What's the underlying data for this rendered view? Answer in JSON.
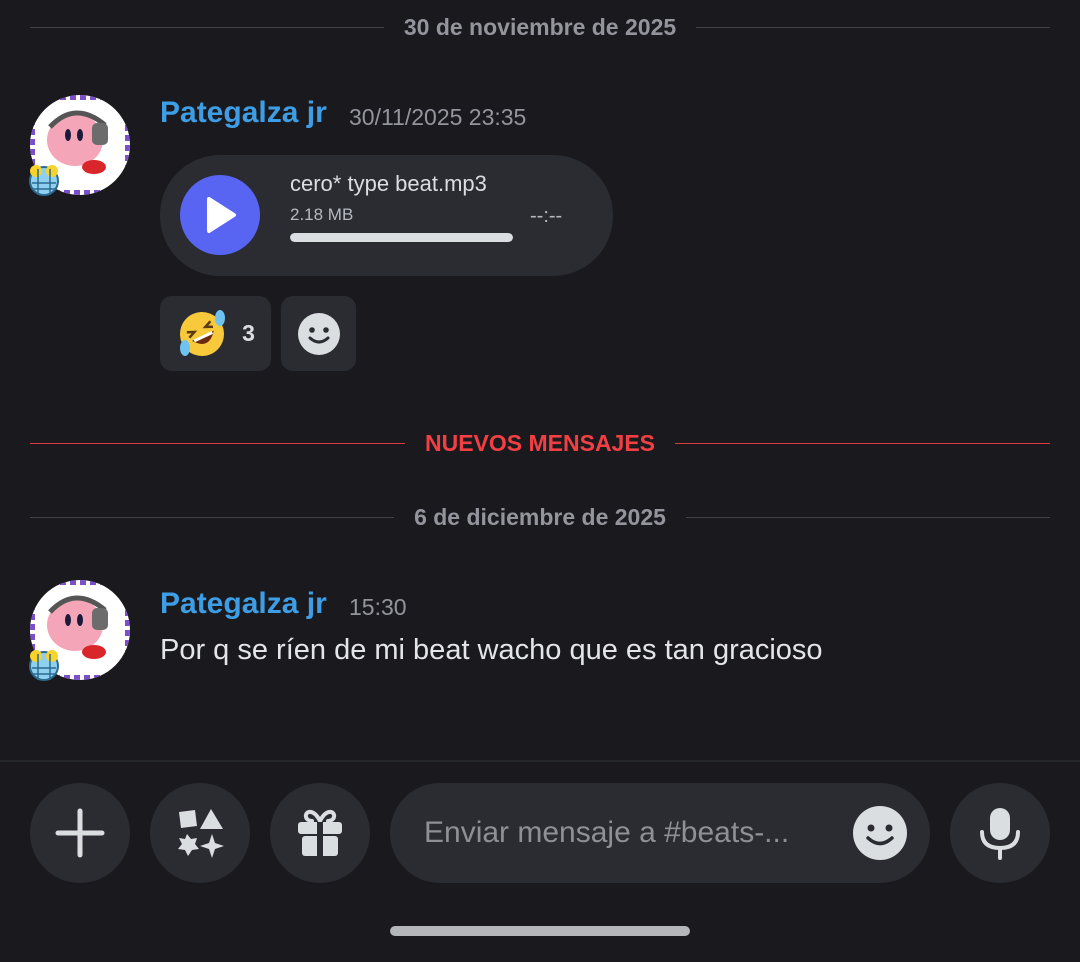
{
  "channel": {
    "date_dividers": [
      "30 de noviembre de 2025",
      "6 de diciembre de 2025"
    ],
    "new_messages_label": "NUEVOS MENSAJES"
  },
  "messages": [
    {
      "author": "Pategalza jr",
      "timestamp": "30/11/2025 23:35",
      "attachment": {
        "type": "audio",
        "file_name": "cero* type beat.mp3",
        "file_size": "2.18 MB",
        "duration": "--:--",
        "progress": 0
      },
      "reactions": [
        {
          "emoji": "rolling-on-floor-laughing",
          "count": "3"
        }
      ]
    },
    {
      "author": "Pategalza jr",
      "timestamp": "15:30",
      "text": "Por q se ríen de mi beat wacho que es tan gracioso"
    }
  ],
  "composer": {
    "placeholder": "Enviar mensaje a #beats-...",
    "buttons": [
      "plus-icon",
      "apps-icon",
      "gift-icon",
      "emoji-icon",
      "microphone-icon"
    ]
  },
  "colors": {
    "background": "#1a1a1e",
    "username": "#3d9ee6",
    "new_messages": "#f23f43",
    "play_button": "#5865f2"
  }
}
